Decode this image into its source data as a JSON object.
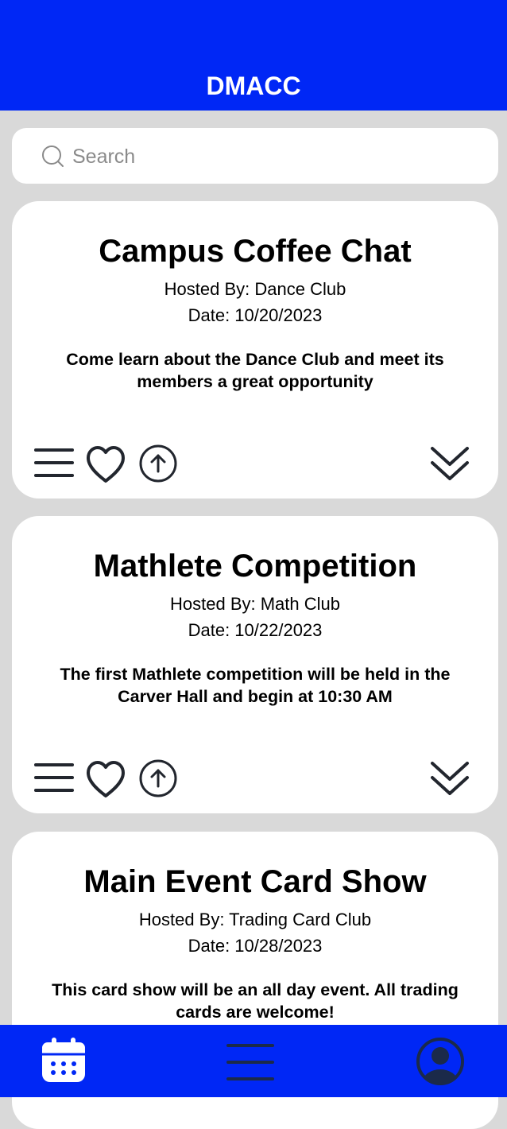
{
  "header": {
    "title": "DMACC"
  },
  "search": {
    "placeholder": "Search"
  },
  "events": [
    {
      "title": "Campus Coffee Chat",
      "host": "Hosted By: Dance Club",
      "date": "Date: 10/20/2023",
      "description": "Come learn about the Dance Club and meet its members a great opportunity"
    },
    {
      "title": "Mathlete Competition",
      "host": "Hosted By: Math Club",
      "date": "Date: 10/22/2023",
      "description": "The first Mathlete competition will be held in the Carver Hall and begin at 10:30 AM"
    },
    {
      "title": "Main Event Card Show",
      "host": "Hosted By: Trading Card Club",
      "date": "Date: 10/28/2023",
      "description": "This card show will be an all day event. All trading cards are welcome!"
    }
  ],
  "card_icons": [
    "menu-icon",
    "heart-icon",
    "share-icon",
    "expand-icon"
  ],
  "bottom_nav": {
    "items": [
      "calendar-icon",
      "menu-icon",
      "profile-icon"
    ]
  },
  "colors": {
    "accent": "#0027f5",
    "background": "#d9d9d9",
    "card": "#ffffff",
    "nav_icon": "#1b2a4a"
  }
}
